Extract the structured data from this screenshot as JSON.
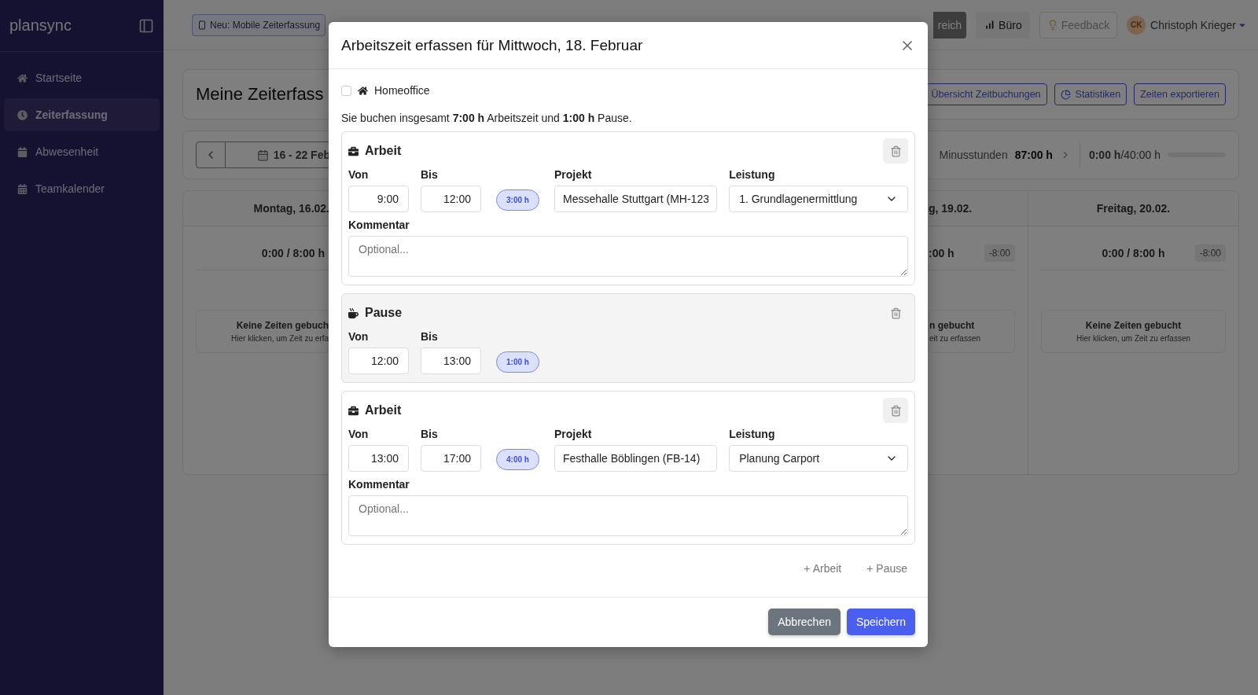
{
  "sidebar": {
    "brand": "plansync",
    "items": [
      {
        "label": "Startseite",
        "selected": false
      },
      {
        "label": "Zeiterfassung",
        "selected": true
      },
      {
        "label": "Abwesenheit",
        "selected": false
      },
      {
        "label": "Teamkalender",
        "selected": false
      }
    ]
  },
  "topbar": {
    "announcement": "Neu: Mobile Zeiterfassung",
    "area_button": "reich",
    "office_button": "Büro",
    "feedback": "Feedback",
    "user": {
      "initials": "CK",
      "name": "Christoph Krieger"
    }
  },
  "page": {
    "title": "Meine Zeiterfass",
    "actions": [
      "Übersicht Zeitbuchungen",
      "Statistiken",
      "Zeiten exportieren"
    ]
  },
  "week_bar": {
    "range": "16 - 22 Feb",
    "balance_label": "Minusstunden",
    "balance_value": "87:00 h",
    "progress": {
      "done": "0:00 h",
      "target": "/40:00 h",
      "level": 0
    }
  },
  "days": [
    {
      "title": "Montag, 16.02.",
      "total": "0:00 / 8:00 h",
      "empty_title": "Keine Zeiten gebuch",
      "empty_hint": "Hier klicken, um Zeit zu erfa"
    },
    {
      "title": "g, 19.02.",
      "total": ":00 h",
      "delta": "-8:00",
      "empty_title": "n gebucht",
      "empty_hint": "eit zu erfassen"
    },
    {
      "title": "Freitag, 20.02.",
      "total": "0:00 / 8:00 h",
      "delta": "-8:00",
      "empty_title": "Keine Zeiten gebucht",
      "empty_hint": "Hier klicken, um Zeit zu erfassen"
    }
  ],
  "dialog": {
    "title": "Arbeitszeit erfassen für Mittwoch, 18. Februar",
    "homeoffice": {
      "label": "Homeoffice",
      "checked": false
    },
    "summary": "Sie buchen insgesamt **7:00 h** Arbeitszeit und **1:00 h** Pause.",
    "entries": [
      {
        "kind": "work",
        "title": "Arbeit",
        "from_label": "Von",
        "from": "9:00",
        "to_label": "Bis",
        "to": "12:00",
        "duration": "3:00 h",
        "project_label": "Projekt",
        "project": "Messehalle Stuttgart (MH-123",
        "service_label": "Leistung",
        "service": "1. Grundlagenermittlung",
        "comment_label": "Kommentar",
        "comment_placeholder": "Optional..."
      },
      {
        "kind": "break",
        "title": "Pause",
        "from_label": "Von",
        "from": "12:00",
        "to_label": "Bis",
        "to": "13:00",
        "duration": "1:00 h"
      },
      {
        "kind": "work",
        "title": "Arbeit",
        "from_label": "Von",
        "from": "13:00",
        "to_label": "Bis",
        "to": "17:00",
        "duration": "4:00 h",
        "project_label": "Projekt",
        "project": "Festhalle Böblingen (FB-14)",
        "service_label": "Leistung",
        "service": "Planung Carport",
        "comment_label": "Kommentar",
        "comment_placeholder": "Optional..."
      }
    ],
    "add_buttons": [
      "+ Arbeit",
      "+ Pause"
    ],
    "cancel": "Abbrechen",
    "save": "Speichern"
  }
}
